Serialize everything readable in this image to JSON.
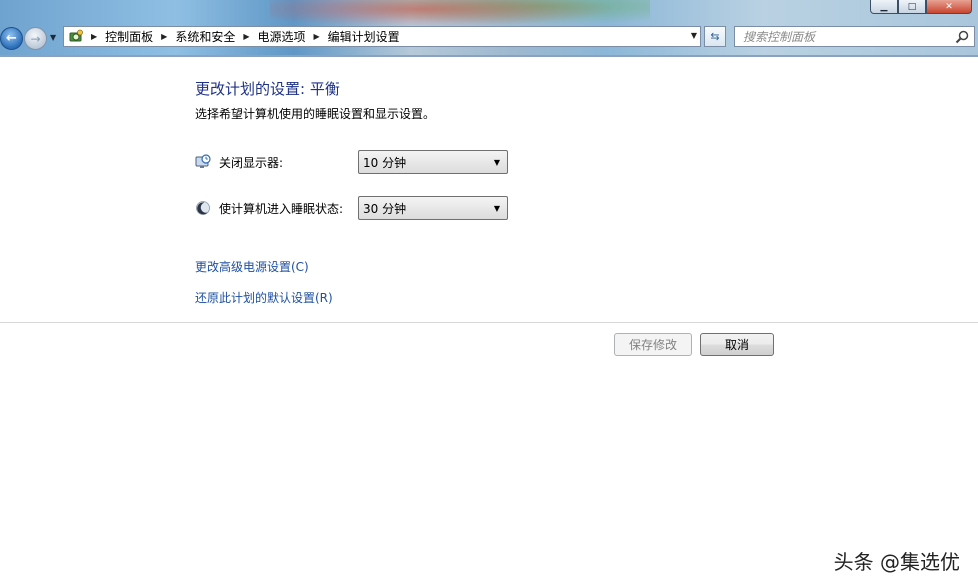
{
  "window": {
    "caption_buttons": [
      "minimize-icon",
      "maximize-icon",
      "close-icon"
    ]
  },
  "nav": {
    "back_icon": "back-arrow-icon",
    "forward_icon": "forward-arrow-icon"
  },
  "address": {
    "icon": "control-panel-icon",
    "breadcrumbs": [
      "控制面板",
      "系统和安全",
      "电源选项",
      "编辑计划设置"
    ]
  },
  "search": {
    "placeholder": "搜索控制面板"
  },
  "main": {
    "title": "更改计划的设置: 平衡",
    "subtitle": "选择希望计算机使用的睡眠设置和显示设置。",
    "settings": [
      {
        "label": "关闭显示器:",
        "value": "10 分钟",
        "icon": "display-timer-icon"
      },
      {
        "label": "使计算机进入睡眠状态:",
        "value": "30 分钟",
        "icon": "sleep-moon-icon"
      }
    ],
    "links": [
      "更改高级电源设置(C)",
      "还原此计划的默认设置(R)"
    ],
    "buttons": {
      "save": "保存修改",
      "cancel": "取消"
    }
  },
  "watermark": "头条 @集选优",
  "colors": {
    "title": "#1e3287",
    "link": "#1e50a2"
  }
}
